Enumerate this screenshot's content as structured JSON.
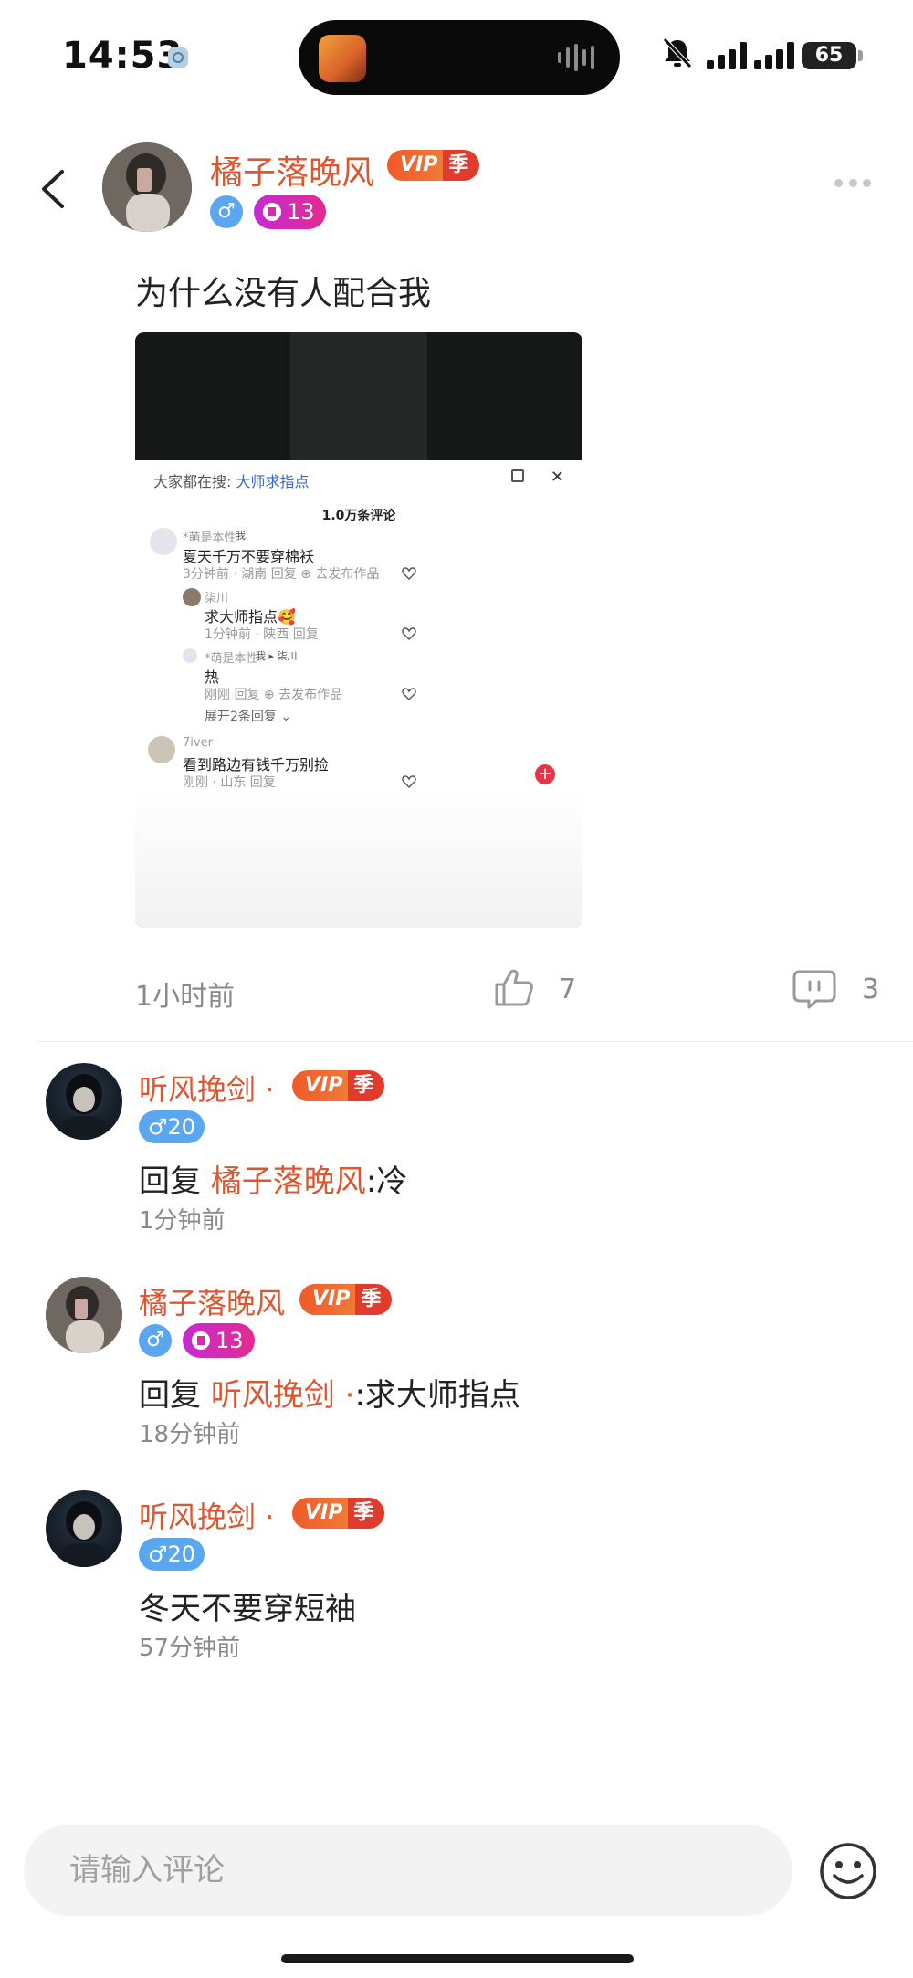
{
  "status_bar": {
    "time": "14:53",
    "battery": "65"
  },
  "post": {
    "author_name": "橘子落晚风",
    "vip_label": "VIP",
    "vip_season": "季",
    "gender_symbol": "♂",
    "level": "13",
    "text": "为什么没有人配合我",
    "time": "1小时前",
    "likes": "7",
    "comments": "3"
  },
  "embedded": {
    "search_prefix": "大家都在搜:",
    "search_term": "大师求指点",
    "comment_count": "1.0万条评论",
    "comments": [
      {
        "name": "*萌是本性",
        "tag": "我",
        "text": "夏天千万不要穿棉袄",
        "meta": "3分钟前 · 湖南   回复   ⊕ 去发布作品"
      },
      {
        "name": "柒川",
        "tag": "",
        "text": "求大师指点🥰",
        "meta": "1分钟前 · 陕西   回复"
      },
      {
        "name": "*萌是本性",
        "tag": "我 ▸ 柒川",
        "text": "热",
        "meta": "刚刚   回复   ⊕ 去发布作品"
      },
      {
        "name": "展开2条回复 ⌄",
        "tag": "",
        "text": "",
        "meta": ""
      },
      {
        "name": "7iver",
        "tag": "",
        "text": "看到路边有钱千万别捡",
        "meta": "刚刚 · 山东   回复"
      }
    ]
  },
  "replies": [
    {
      "name": "听风挽剑 ·",
      "level": "♂20",
      "body_prefix": "回复 ",
      "mention": "橘子落晚风",
      "body_suffix": ":冷",
      "time": "1分钟前"
    },
    {
      "name": "橘子落晚风",
      "level": "13",
      "body_prefix": "回复 ",
      "mention": "听风挽剑 ·",
      "body_suffix": ":求大师指点",
      "time": "18分钟前"
    },
    {
      "name": "听风挽剑 ·",
      "level": "♂20",
      "body_prefix": "",
      "mention": "",
      "body_suffix": "冬天不要穿短袖",
      "time": "57分钟前"
    }
  ],
  "input": {
    "placeholder": "请输入评论"
  },
  "icons": {
    "back": "back-chevron-icon",
    "more": "more-dots-icon",
    "like": "thumbs-up-icon",
    "comment": "comment-bubble-icon",
    "emoji": "smiley-face-icon"
  },
  "colors": {
    "accent_name": "#e0542e",
    "vip_orange": "#f05a2a",
    "level_blue": "#5aa7f0",
    "level_pink": "#d62ca8"
  }
}
